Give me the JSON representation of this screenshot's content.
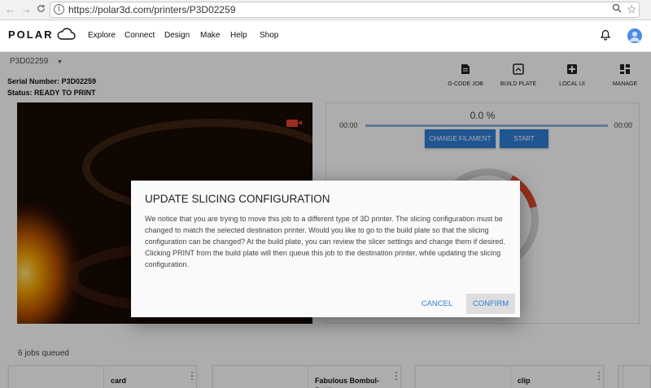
{
  "browser": {
    "back": "←",
    "forward": "→",
    "reload": "C",
    "url": "https://polar3d.com/printers/P3D02259"
  },
  "header": {
    "logo_text": "POLAR",
    "nav": [
      "Explore",
      "Connect",
      "Design",
      "Make",
      "Help",
      "Shop"
    ]
  },
  "printer": {
    "selected": "P3D02259",
    "serial_label": "Serial Number: P3D02259",
    "status_label": "Status: READY TO PRINT"
  },
  "actions": [
    "G-CODE JOB",
    "BUILD PLATE",
    "LOCAL UI",
    "MANAGE"
  ],
  "control": {
    "progress": "0.0 %",
    "progress_value": 0,
    "time_left": "00:00",
    "time_right": "00:00",
    "change_filament": "CHANGE FILAMENT",
    "start": "START"
  },
  "jobs": {
    "count_label": "6 jobs queued",
    "cards": [
      {
        "title": "card"
      },
      {
        "title": "Fabulous Bombul-Rattle"
      },
      {
        "title": "clip"
      }
    ]
  },
  "dialog": {
    "title": "UPDATE SLICING CONFIGURATION",
    "body": "We notice that you are trying to move this job to a different type of 3D printer. The slicing configuration must be changed to match the selected destination printer. Would you like to go to the build plate so that the slicing configuration can be changed? At the build plate, you can review the slicer settings and change them if desired. Clicking PRINT from the build plate will then queue this job to the destination printer, while updating the slicing configuration.",
    "cancel": "CANCEL",
    "confirm": "CONFIRM"
  },
  "colors": {
    "accent": "#2e7ed6",
    "camera_indicator": "#e0452b",
    "gauge_arc": "#e24a2a"
  }
}
